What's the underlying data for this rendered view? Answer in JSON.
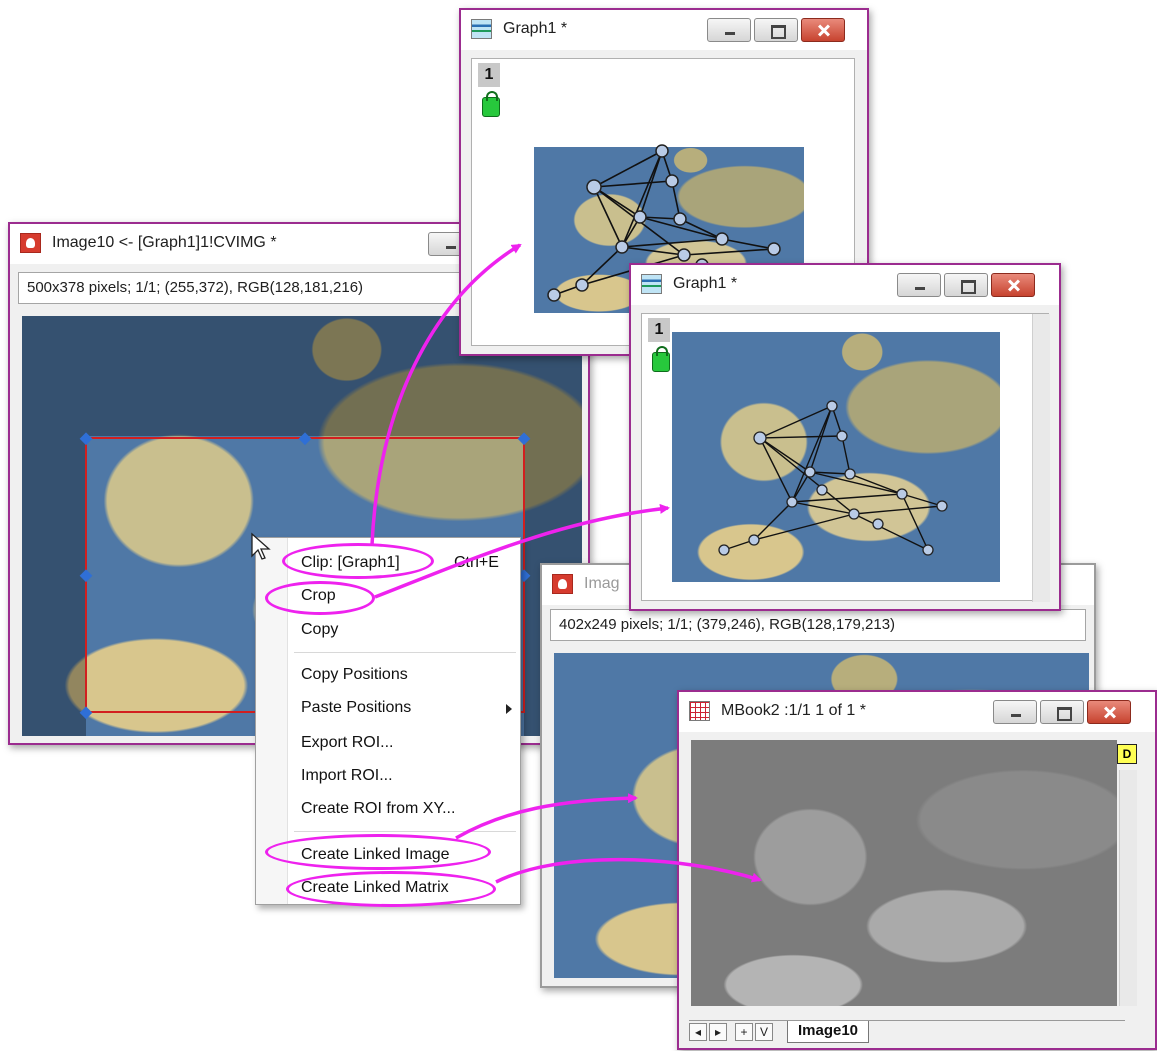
{
  "image_window": {
    "title": "Image10 <- [Graph1]1!CVIMG *",
    "status": "500x378 pixels; 1/1; (255,372), RGB(128,181,216)"
  },
  "context_menu": {
    "items": [
      {
        "label": "Clip: [Graph1]",
        "shortcut": "Ctrl+E"
      },
      {
        "label": "Crop"
      },
      {
        "label": "Copy"
      },
      {
        "label": "Copy Positions"
      },
      {
        "label": "Paste Positions",
        "has_submenu": true
      },
      {
        "label": "Export ROI..."
      },
      {
        "label": "Import ROI..."
      },
      {
        "label": "Create ROI from XY..."
      },
      {
        "label": "Create Linked Image"
      },
      {
        "label": "Create Linked Matrix"
      }
    ]
  },
  "graph_window_1": {
    "title": "Graph1 *",
    "layer": "1"
  },
  "graph_window_2": {
    "title": "Graph1 *",
    "layer": "1"
  },
  "image_window_2": {
    "title": "Imag",
    "status": "402x249 pixels; 1/1; (379,246), RGB(128,179,213)"
  },
  "matrix_window": {
    "title": "MBook2 :1/1 1 of 1 *",
    "sheet_tab": "Image10",
    "badge": "D",
    "nav": [
      "◂",
      "▸",
      "+",
      "V"
    ]
  },
  "colors": {
    "window_border": "#9b2c8f",
    "highlight": "#ee22ee",
    "ocean": "#4f78a6"
  }
}
